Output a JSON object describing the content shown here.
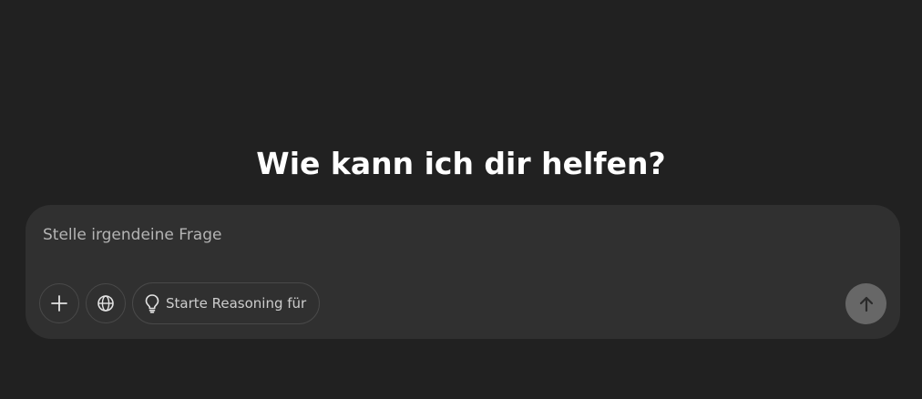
{
  "main": {
    "heading": "Wie kann ich dir helfen?"
  },
  "composer": {
    "placeholder": "Stelle irgendeine Frage",
    "value": "",
    "tools": {
      "attach_icon": "plus-icon",
      "search_icon": "globe-icon",
      "reasoning": {
        "icon": "lightbulb-icon",
        "label": "Starte Reasoning für"
      }
    },
    "send_icon": "arrow-up-icon"
  },
  "colors": {
    "background": "#212121",
    "composer_bg": "#303030",
    "button_border": "#494949",
    "send_button": "#676767",
    "heading_text": "#ffffff",
    "placeholder_text": "#b4b4b4"
  }
}
